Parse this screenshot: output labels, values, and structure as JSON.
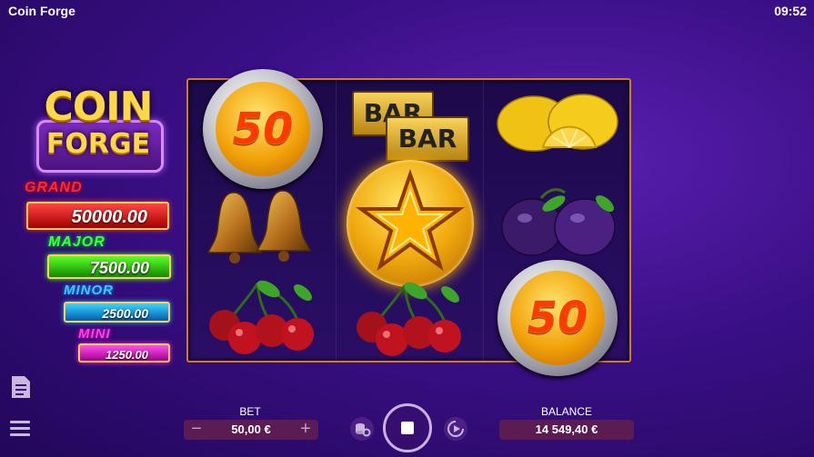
{
  "app": {
    "title": "Coin Forge",
    "clock": "09:52"
  },
  "logo": {
    "line1": "COIN",
    "line2": "FORGE"
  },
  "jackpots": [
    {
      "name": "GRAND",
      "value": "50000.00",
      "color": "#ff2a2a"
    },
    {
      "name": "MAJOR",
      "value": "7500.00",
      "color": "#3dff3d"
    },
    {
      "name": "MINOR",
      "value": "2500.00",
      "color": "#3ec6ff"
    },
    {
      "name": "MINI",
      "value": "1250.00",
      "color": "#ff3fe0"
    }
  ],
  "reels": {
    "reel1": [
      "coin-50",
      "bells",
      "cherries"
    ],
    "reel2": [
      "double-bar",
      "star-coin",
      "cherries"
    ],
    "reel3": [
      "lemon",
      "plums",
      "coin-50"
    ],
    "coin_value": "50",
    "bar_text": "BAR"
  },
  "controls": {
    "bet_label": "BET",
    "bet_value": "50,00 €",
    "minus": "−",
    "plus": "+",
    "balance_label": "BALANCE",
    "balance_value": "14 549,40 €"
  },
  "colors": {
    "accent": "#d17a2a",
    "panel": "#5a1c53"
  }
}
